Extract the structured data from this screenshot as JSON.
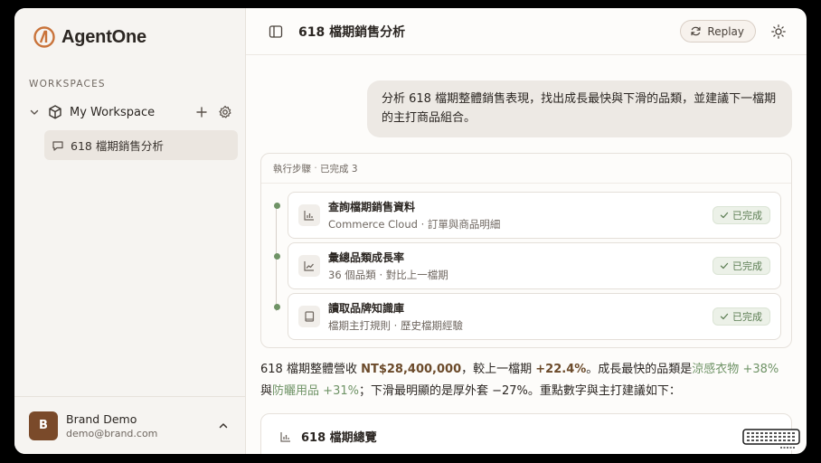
{
  "app": {
    "name": "AgentOne"
  },
  "sidebar": {
    "workspaces_heading": "WORKSPACES",
    "workspace_name": "My Workspace",
    "conversation_label": "618 檔期銷售分析",
    "user": {
      "initial": "B",
      "name": "Brand Demo",
      "email": "demo@brand.com"
    }
  },
  "header": {
    "title": "618 檔期銷售分析",
    "replay_label": "Replay"
  },
  "message": {
    "user_text": "分析 618 檔期整體銷售表現，找出成長最快與下滑的品類，並建議下一檔期的主打商品組合。"
  },
  "steps": {
    "heading": "執行步驟",
    "separator": "·",
    "status": "已完成 3",
    "items": [
      {
        "title": "查詢檔期銷售資料",
        "subtitle": "Commerce Cloud · 訂單與商品明細",
        "status": "已完成",
        "icon": "bar-chart-icon"
      },
      {
        "title": "彙總品類成長率",
        "subtitle": "36 個品類 · 對比上一檔期",
        "status": "已完成",
        "icon": "line-chart-icon"
      },
      {
        "title": "讀取品牌知識庫",
        "subtitle": "檔期主打規則 · 歷史檔期經驗",
        "status": "已完成",
        "icon": "book-icon"
      }
    ]
  },
  "summary": {
    "p1": "618 檔期整體營收 ",
    "revenue": "NT$28,400,000",
    "p2": "，較上一檔期 ",
    "growth": "+22.4%",
    "p3": "。成長最快的品類是",
    "cat1": "涼感衣物",
    "cat1_growth": "+38%",
    "p4": " 與",
    "cat2": "防曬用品",
    "cat2_growth": "+31%",
    "p5": "；下滑最明顯的是厚外套 −27%。重點數字與主打建議如下："
  },
  "overview": {
    "title": "618 檔期總覽"
  },
  "colors": {
    "accent": "#6b4a2a",
    "logo": "#c9733a",
    "success": "#5e7f55",
    "avatar": "#7a4a2a"
  }
}
